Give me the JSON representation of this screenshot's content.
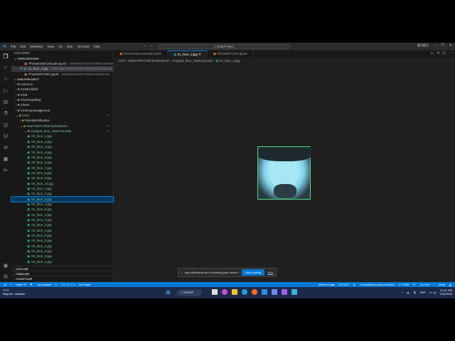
{
  "menu": [
    "File",
    "Edit",
    "Selection",
    "View",
    "Go",
    "Run",
    "Terminal",
    "Help"
  ],
  "search": "DailyProject",
  "explorer": {
    "title": "EXPLORER",
    "open_editors": "OPEN EDITORS",
    "project": "DAILYPROJECT",
    "editors": [
      {
        "name": "PhotosHaarCascade.ipynb",
        "path": "CNN\\HaarVsMTCNNFaceDetector"
      },
      {
        "name": "01_face_3.jpg",
        "path": "CNN\\HaarVsMTCNNFaceDetector\\cropped_face_Haar..."
      },
      {
        "name": "PhotosMTCNN.ipynb",
        "path": "CNN\\HaarVsMTCNNFaceDetector"
      }
    ],
    "folders": [
      {
        "name": "Lanonos",
        "lvl": 0
      },
      {
        "name": "CesarCipher",
        "lvl": 0
      },
      {
        "name": "Chat",
        "lvl": 0
      },
      {
        "name": "CheckSpelling",
        "lvl": 0
      },
      {
        "name": "Chess",
        "lvl": 0
      },
      {
        "name": "Cinemamanagement",
        "lvl": 0
      },
      {
        "name": "CNN",
        "lvl": 0,
        "open": true,
        "green": true
      },
      {
        "name": "FaceIdentification",
        "lvl": 1
      },
      {
        "name": "HaarVsMTCNNFaceDetector",
        "lvl": 1,
        "open": true,
        "green": true
      },
      {
        "name": "cropped_face_HaarCascade",
        "lvl": 2,
        "open": true,
        "green": true
      }
    ],
    "files": [
      "00_face_1.jpg",
      "00_face_2.jpg",
      "00_face_3.jpg",
      "00_face_4.jpg",
      "00_face_5.jpg",
      "00_face_6.jpg",
      "00_face_7.jpg",
      "00_face_8.jpg",
      "00_face_9.jpg",
      "00_face_10.jpg",
      "01_face_1.jpg",
      "01_face_2.jpg",
      "01_face_3.jpg",
      "01_face_4.jpg",
      "01_face_5.jpg",
      "02_face_1.jpg",
      "02_face_2.jpg",
      "02_face_3.jpg",
      "02_face_4.jpg",
      "02_face_5.jpg",
      "02_face_6.jpg",
      "03_face_1.jpg",
      "03_face_2.jpg",
      "03_face_3.jpg",
      "04_face_1.jpg"
    ],
    "selected": "01_face_3.jpg",
    "bottom": [
      "OUTLINE",
      "TIMELINE",
      "CODETOUR"
    ]
  },
  "tabs": [
    "PhotosHaarCascade.ipynb",
    "01_face_3.jpg",
    "PhotosMTCNN.ipynb"
  ],
  "breadcrumb": [
    "CNN",
    "HaarVsMTCNNFaceDetector",
    "cropped_face_HaarCascade",
    "01_face_3.jpg"
  ],
  "share": {
    "text": "app.clipchamp.com is sharing your screen.",
    "stop": "Stop sharing",
    "hide": "Hide"
  },
  "status": {
    "branch": "main*",
    "launchpad": "Launchpad",
    "problems": "0 ⚠ 0 ⓘ 0",
    "gitgraph": "Git Graph",
    "image": "Whole Image",
    "size": "227x227",
    "completions": "Completions quota reached",
    "filesize": "17.79KB",
    "golive": "Go Live",
    "ninja": "Ninja"
  },
  "taskbar": {
    "temp": "17°C",
    "weather": "Mayorm. nublado",
    "search": "Search",
    "lang": "ESP",
    "time": "12:41 PM",
    "date": "7/31/2024"
  }
}
